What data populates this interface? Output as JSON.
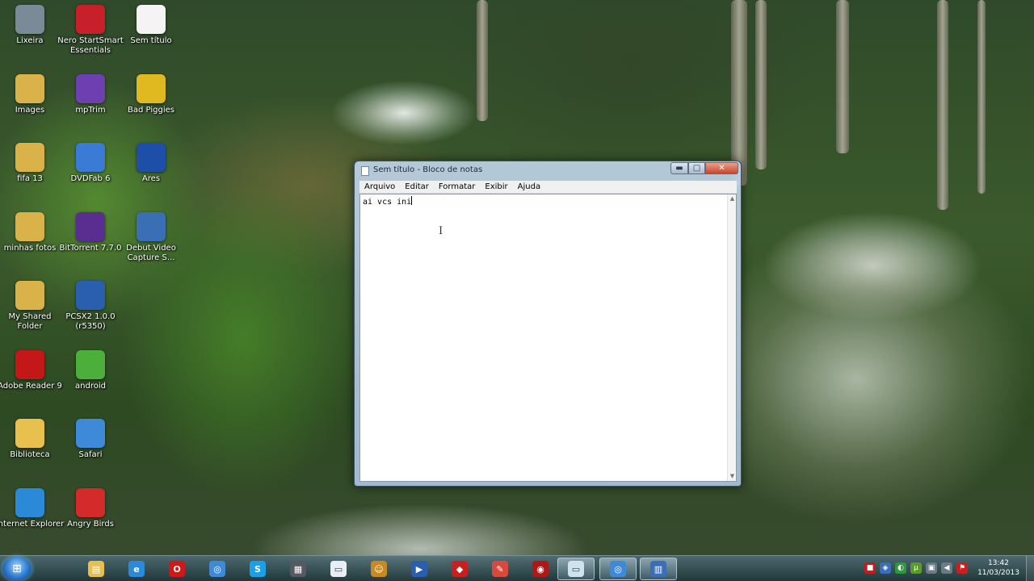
{
  "desktop": {
    "icons": [
      {
        "label": "Lixeira",
        "icon": "recycle-bin-icon",
        "color": "#7a8a96"
      },
      {
        "label": "Nero StartSmart Essentials",
        "icon": "nero-icon",
        "color": "#c8202a"
      },
      {
        "label": "Sem título",
        "icon": "text-file-icon",
        "color": "#f4f4f4"
      },
      {
        "label": "Images",
        "icon": "folder-icon",
        "color": "#d9b34a"
      },
      {
        "label": "mpTrim",
        "icon": "mptrim-icon",
        "color": "#6d3fb0"
      },
      {
        "label": "Bad Piggies",
        "icon": "bad-piggies-icon",
        "color": "#e0b820"
      },
      {
        "label": "fifa 13",
        "icon": "folder-icon",
        "color": "#d9b34a"
      },
      {
        "label": "DVDFab 6",
        "icon": "dvdfab-icon",
        "color": "#3b7bd6"
      },
      {
        "label": "Ares",
        "icon": "ares-icon",
        "color": "#1e4fa8"
      },
      {
        "label": "minhas fotos",
        "icon": "folder-icon",
        "color": "#d9b34a"
      },
      {
        "label": "BitTorrent 7.7.0",
        "icon": "bittorrent-icon",
        "color": "#5a2d90"
      },
      {
        "label": "Debut Video Capture S...",
        "icon": "debut-video-icon",
        "color": "#3a6fb5"
      },
      {
        "label": "My Shared Folder",
        "icon": "folder-icon",
        "color": "#d9b34a"
      },
      {
        "label": "PCSX2 1.0.0 (r5350)",
        "icon": "pcsx2-icon",
        "color": "#2a5fb0"
      },
      {
        "label": "Adobe Reader 9",
        "icon": "adobe-reader-icon",
        "color": "#c41818"
      },
      {
        "label": "android",
        "icon": "bluestacks-icon",
        "color": "#4caf3c"
      },
      {
        "label": "Biblioteca",
        "icon": "library-folder-icon",
        "color": "#e8c050"
      },
      {
        "label": "Safari",
        "icon": "safari-icon",
        "color": "#3f8ad8"
      },
      {
        "label": "Internet Explorer",
        "icon": "internet-explorer-icon",
        "color": "#2a8ad8"
      },
      {
        "label": "Angry Birds",
        "icon": "angry-birds-icon",
        "color": "#d42a2a"
      }
    ]
  },
  "notepad": {
    "title": "Sem título - Bloco de notas",
    "menu": [
      "Arquivo",
      "Editar",
      "Formatar",
      "Exibir",
      "Ajuda"
    ],
    "content": "ai vcs ini",
    "controls": {
      "minimize": "▬",
      "maximize": "□",
      "close": "✕"
    },
    "scroll": {
      "up": "▲",
      "down": "▼"
    },
    "ibeam": "I"
  },
  "taskbar": {
    "start_icon": "windows-start-orb-icon",
    "start_glyph": "⊞",
    "apps": [
      {
        "icon": "windows-explorer-icon",
        "color": "#e8c050",
        "glyph": "▤",
        "active": false
      },
      {
        "icon": "internet-explorer-icon",
        "color": "#2a8ad8",
        "glyph": "e",
        "active": false
      },
      {
        "icon": "opera-icon",
        "color": "#d01818",
        "glyph": "O",
        "active": false
      },
      {
        "icon": "safari-icon",
        "color": "#3f8ad8",
        "glyph": "◎",
        "active": false
      },
      {
        "icon": "skype-icon",
        "color": "#1aa0e8",
        "glyph": "S",
        "active": false
      },
      {
        "icon": "media-icon",
        "color": "#555a60",
        "glyph": "▦",
        "active": false
      },
      {
        "icon": "notepad-icon",
        "color": "#e8eef4",
        "glyph": "▭",
        "active": false
      },
      {
        "icon": "game-icon",
        "color": "#c88a20",
        "glyph": "☺",
        "active": false
      },
      {
        "icon": "pcsx2-icon",
        "color": "#2a5fb0",
        "glyph": "▶",
        "active": false
      },
      {
        "icon": "cars-icon",
        "color": "#c82020",
        "glyph": "◆",
        "active": false
      },
      {
        "icon": "paint-icon",
        "color": "#d84a40",
        "glyph": "✎",
        "active": false
      },
      {
        "icon": "target-icon",
        "color": "#b01818",
        "glyph": "◉",
        "active": false
      },
      {
        "icon": "notepad-icon",
        "color": "#cfe2ee",
        "glyph": "▭",
        "active": true
      },
      {
        "icon": "safari-icon",
        "color": "#3f8ad8",
        "glyph": "◎",
        "active": true
      },
      {
        "icon": "debut-video-icon",
        "color": "#3a6fb5",
        "glyph": "▥",
        "active": true
      }
    ],
    "tray": [
      {
        "icon": "antivirus-icon",
        "color": "#c81818",
        "glyph": "■"
      },
      {
        "icon": "shield-icon",
        "color": "#3a6fb5",
        "glyph": "◈"
      },
      {
        "icon": "whatsapp-icon",
        "color": "#2a9a3a",
        "glyph": "◐"
      },
      {
        "icon": "utorrent-icon",
        "color": "#5a9a2a",
        "glyph": "µ"
      },
      {
        "icon": "network-icon",
        "color": "#6a7a88",
        "glyph": "▣"
      },
      {
        "icon": "volume-icon",
        "color": "#6a7a88",
        "glyph": "◀"
      },
      {
        "icon": "action-center-flag-icon",
        "color": "#c82020",
        "glyph": "⚑"
      }
    ],
    "clock": {
      "time": "13:42",
      "date": "11/03/2013"
    }
  }
}
